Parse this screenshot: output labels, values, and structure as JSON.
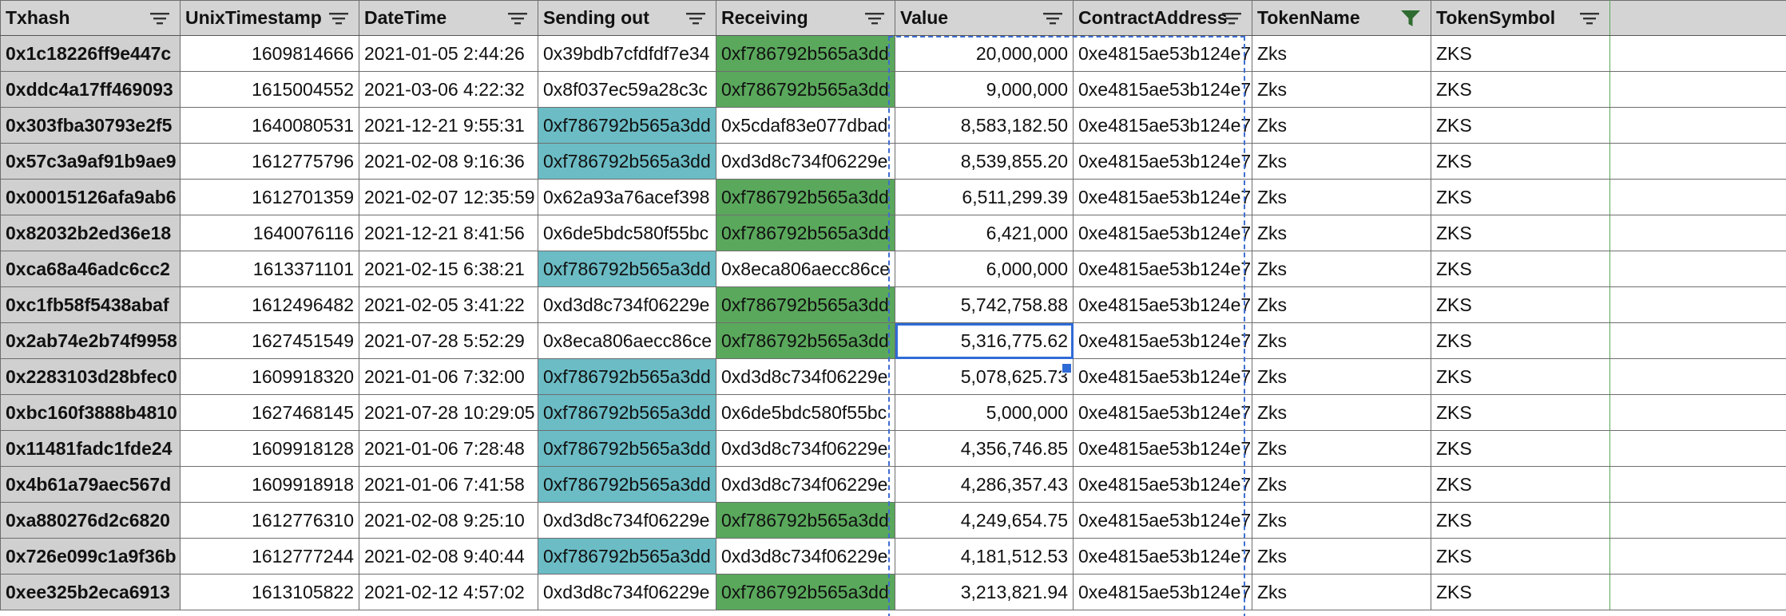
{
  "columns": [
    {
      "label": "Txhash",
      "filter": "sort-filter-icon"
    },
    {
      "label": "UnixTimestamp",
      "filter": "sort-filter-icon"
    },
    {
      "label": "DateTime",
      "filter": "sort-filter-icon"
    },
    {
      "label": "Sending out",
      "filter": "sort-filter-icon"
    },
    {
      "label": "Receiving",
      "filter": "sort-filter-icon"
    },
    {
      "label": "Value",
      "filter": "sort-filter-icon"
    },
    {
      "label": "ContractAddress",
      "filter": "sort-filter-icon"
    },
    {
      "label": "TokenName",
      "filter": "funnel-filter-active-icon"
    },
    {
      "label": "TokenSymbol",
      "filter": "sort-filter-icon"
    }
  ],
  "colors": {
    "header_bg": "#d4d4d4",
    "txhash_bg": "#d0d0d0",
    "highlight_teal": "#6bbcc5",
    "highlight_green": "#5aa85c",
    "selection": "#2f6bd6",
    "active_filter": "#2e6b2f"
  },
  "rows": [
    {
      "txhash": "0x1c18226ff9e447c",
      "ts": "1609814666",
      "dt": "2021-01-05 2:44:26",
      "send": "0x39bdb7cfdfdf7e34",
      "recv": "0xf786792b565a3dd",
      "value": "20,000,000",
      "contract": "0xe4815ae53b124e7",
      "name": "Zks",
      "symbol": "ZKS",
      "hs": "",
      "hr": "green"
    },
    {
      "txhash": "0xddc4a17ff469093",
      "ts": "1615004552",
      "dt": "2021-03-06 4:22:32",
      "send": "0x8f037ec59a28c3c",
      "recv": "0xf786792b565a3dd",
      "value": "9,000,000",
      "contract": "0xe4815ae53b124e7",
      "name": "Zks",
      "symbol": "ZKS",
      "hs": "",
      "hr": "green"
    },
    {
      "txhash": "0x303fba30793e2f5",
      "ts": "1640080531",
      "dt": "2021-12-21 9:55:31",
      "send": "0xf786792b565a3dd",
      "recv": "0x5cdaf83e077dbad",
      "value": "8,583,182.50",
      "contract": "0xe4815ae53b124e7",
      "name": "Zks",
      "symbol": "ZKS",
      "hs": "teal",
      "hr": ""
    },
    {
      "txhash": "0x57c3a9af91b9ae9",
      "ts": "1612775796",
      "dt": "2021-02-08 9:16:36",
      "send": "0xf786792b565a3dd",
      "recv": "0xd3d8c734f06229e",
      "value": "8,539,855.20",
      "contract": "0xe4815ae53b124e7",
      "name": "Zks",
      "symbol": "ZKS",
      "hs": "teal",
      "hr": ""
    },
    {
      "txhash": "0x00015126afa9ab6",
      "ts": "1612701359",
      "dt": "2021-02-07 12:35:59",
      "send": "0x62a93a76acef398",
      "recv": "0xf786792b565a3dd",
      "value": "6,511,299.39",
      "contract": "0xe4815ae53b124e7",
      "name": "Zks",
      "symbol": "ZKS",
      "hs": "",
      "hr": "green"
    },
    {
      "txhash": "0x82032b2ed36e18",
      "ts": "1640076116",
      "dt": "2021-12-21 8:41:56",
      "send": "0x6de5bdc580f55bc",
      "recv": "0xf786792b565a3dd",
      "value": "6,421,000",
      "contract": "0xe4815ae53b124e7",
      "name": "Zks",
      "symbol": "ZKS",
      "hs": "",
      "hr": "green"
    },
    {
      "txhash": "0xca68a46adc6cc2",
      "ts": "1613371101",
      "dt": "2021-02-15 6:38:21",
      "send": "0xf786792b565a3dd",
      "recv": "0x8eca806aecc86ce",
      "value": "6,000,000",
      "contract": "0xe4815ae53b124e7",
      "name": "Zks",
      "symbol": "ZKS",
      "hs": "teal",
      "hr": ""
    },
    {
      "txhash": "0xc1fb58f5438abaf",
      "ts": "1612496482",
      "dt": "2021-02-05 3:41:22",
      "send": "0xd3d8c734f06229e",
      "recv": "0xf786792b565a3dd",
      "value": "5,742,758.88",
      "contract": "0xe4815ae53b124e7",
      "name": "Zks",
      "symbol": "ZKS",
      "hs": "",
      "hr": "green"
    },
    {
      "txhash": "0x2ab74e2b74f9958",
      "ts": "1627451549",
      "dt": "2021-07-28 5:52:29",
      "send": "0x8eca806aecc86ce",
      "recv": "0xf786792b565a3dd",
      "value": "5,316,775.62",
      "contract": "0xe4815ae53b124e7",
      "name": "Zks",
      "symbol": "ZKS",
      "hs": "",
      "hr": "green",
      "selected": true
    },
    {
      "txhash": "0x2283103d28bfec0",
      "ts": "1609918320",
      "dt": "2021-01-06 7:32:00",
      "send": "0xf786792b565a3dd",
      "recv": "0xd3d8c734f06229e",
      "value": "5,078,625.73",
      "contract": "0xe4815ae53b124e7",
      "name": "Zks",
      "symbol": "ZKS",
      "hs": "teal",
      "hr": ""
    },
    {
      "txhash": "0xbc160f3888b4810",
      "ts": "1627468145",
      "dt": "2021-07-28 10:29:05",
      "send": "0xf786792b565a3dd",
      "recv": "0x6de5bdc580f55bc",
      "value": "5,000,000",
      "contract": "0xe4815ae53b124e7",
      "name": "Zks",
      "symbol": "ZKS",
      "hs": "teal",
      "hr": ""
    },
    {
      "txhash": "0x11481fadc1fde24",
      "ts": "1609918128",
      "dt": "2021-01-06 7:28:48",
      "send": "0xf786792b565a3dd",
      "recv": "0xd3d8c734f06229e",
      "value": "4,356,746.85",
      "contract": "0xe4815ae53b124e7",
      "name": "Zks",
      "symbol": "ZKS",
      "hs": "teal",
      "hr": ""
    },
    {
      "txhash": "0x4b61a79aec567d",
      "ts": "1609918918",
      "dt": "2021-01-06 7:41:58",
      "send": "0xf786792b565a3dd",
      "recv": "0xd3d8c734f06229e",
      "value": "4,286,357.43",
      "contract": "0xe4815ae53b124e7",
      "name": "Zks",
      "symbol": "ZKS",
      "hs": "teal",
      "hr": ""
    },
    {
      "txhash": "0xa880276d2c6820",
      "ts": "1612776310",
      "dt": "2021-02-08 9:25:10",
      "send": "0xd3d8c734f06229e",
      "recv": "0xf786792b565a3dd",
      "value": "4,249,654.75",
      "contract": "0xe4815ae53b124e7",
      "name": "Zks",
      "symbol": "ZKS",
      "hs": "",
      "hr": "green"
    },
    {
      "txhash": "0x726e099c1a9f36b",
      "ts": "1612777244",
      "dt": "2021-02-08 9:40:44",
      "send": "0xf786792b565a3dd",
      "recv": "0xd3d8c734f06229e",
      "value": "4,181,512.53",
      "contract": "0xe4815ae53b124e7",
      "name": "Zks",
      "symbol": "ZKS",
      "hs": "teal",
      "hr": ""
    },
    {
      "txhash": "0xee325b2eca6913",
      "ts": "1613105822",
      "dt": "2021-02-12 4:57:02",
      "send": "0xd3d8c734f06229e",
      "recv": "0xf786792b565a3dd",
      "value": "3,213,821.94",
      "contract": "0xe4815ae53b124e7",
      "name": "Zks",
      "symbol": "ZKS",
      "hs": "",
      "hr": "green"
    }
  ]
}
